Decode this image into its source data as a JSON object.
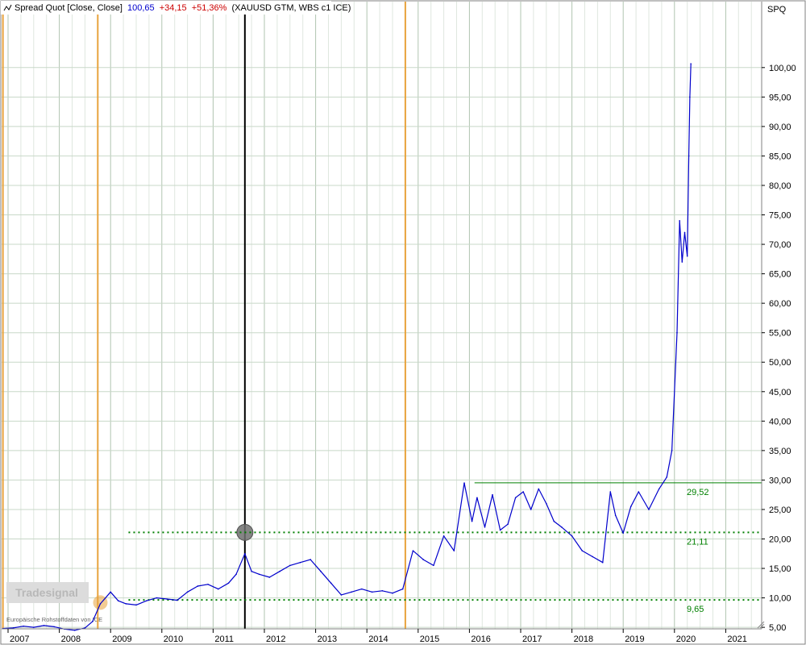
{
  "header": {
    "icon": "line-chart-icon",
    "label": "Spread Quot [Close, Close]",
    "last_value": "100,65",
    "change_abs": "+34,15",
    "change_pct": "+51,36%",
    "instruments": "(XAUUSD GTM, WBS c1 ICE)",
    "colors": {
      "label": "#000000",
      "last_value": "#0000cc",
      "change": "#cc0000"
    }
  },
  "axis": {
    "symbol": "SPQ",
    "y_ticks": [
      "5,00",
      "10,00",
      "15,00",
      "20,00",
      "25,00",
      "30,00",
      "35,00",
      "40,00",
      "45,00",
      "50,00",
      "55,00",
      "60,00",
      "65,00",
      "70,00",
      "75,00",
      "80,00",
      "85,00",
      "90,00",
      "95,00",
      "100,00"
    ],
    "x_ticks": [
      "2007",
      "2008",
      "2009",
      "2010",
      "2011",
      "2012",
      "2013",
      "2014",
      "2015",
      "2016",
      "2017",
      "2018",
      "2019",
      "2020",
      "2021"
    ]
  },
  "levels": [
    {
      "value": 29.52,
      "label": "29,52",
      "style": "solid",
      "from": 2016.1
    },
    {
      "value": 21.11,
      "label": "21,11",
      "style": "dotted",
      "from": 2009.35
    },
    {
      "value": 9.65,
      "label": "9,65",
      "style": "dotted",
      "from": 2009.35
    }
  ],
  "markers": {
    "orange_lines": [
      2006.9,
      2008.75,
      2014.75
    ],
    "black_line": 2011.62,
    "grey_circle": {
      "x": 2011.62,
      "y": 21.11
    },
    "orange_circle": {
      "x": 2008.8,
      "y": 9.2
    }
  },
  "watermark": {
    "logo_text": "Tradesignal",
    "caption": "Europäische Rohstoffdaten von ICE"
  },
  "colors": {
    "series": "#0000cc",
    "level": "#008000",
    "level_label": "#008000",
    "orange": "#e8a33d",
    "marker_black": "#000000",
    "grid": "#c8d8c8"
  },
  "chart_data": {
    "type": "line",
    "title": "",
    "xlabel": "",
    "ylabel": "SPQ",
    "xlim": [
      2006.8,
      2021.7
    ],
    "ylim": [
      0,
      105
    ],
    "grid": true,
    "series": [
      {
        "name": "Spread Quot",
        "x": [
          2006.9,
          2007.1,
          2007.3,
          2007.5,
          2007.7,
          2007.9,
          2008.1,
          2008.3,
          2008.5,
          2008.65,
          2008.8,
          2009.0,
          2009.15,
          2009.3,
          2009.5,
          2009.7,
          2009.9,
          2010.1,
          2010.3,
          2010.5,
          2010.7,
          2010.9,
          2011.1,
          2011.3,
          2011.45,
          2011.62,
          2011.75,
          2011.9,
          2012.1,
          2012.3,
          2012.5,
          2012.7,
          2012.9,
          2013.1,
          2013.3,
          2013.5,
          2013.7,
          2013.9,
          2014.1,
          2014.3,
          2014.5,
          2014.7,
          2014.9,
          2015.1,
          2015.3,
          2015.5,
          2015.7,
          2015.9,
          2016.05,
          2016.15,
          2016.3,
          2016.45,
          2016.6,
          2016.75,
          2016.9,
          2017.05,
          2017.2,
          2017.35,
          2017.5,
          2017.65,
          2017.8,
          2018.0,
          2018.2,
          2018.4,
          2018.6,
          2018.75,
          2018.85,
          2019.0,
          2019.15,
          2019.3,
          2019.5,
          2019.7,
          2019.85,
          2019.95,
          2020.05,
          2020.1,
          2020.15,
          2020.2,
          2020.25,
          2020.28,
          2020.3,
          2020.32
        ],
        "values": [
          4.8,
          4.9,
          5.2,
          5.0,
          5.3,
          5.1,
          4.7,
          4.5,
          4.9,
          6.0,
          9.0,
          11.0,
          9.5,
          9.0,
          8.8,
          9.5,
          10.0,
          9.8,
          9.6,
          11.0,
          12.0,
          12.3,
          11.5,
          12.5,
          14.0,
          17.5,
          14.5,
          14.0,
          13.5,
          14.5,
          15.5,
          16.0,
          16.5,
          14.5,
          12.5,
          10.5,
          11.0,
          11.5,
          11.0,
          11.2,
          10.8,
          11.5,
          18.0,
          16.5,
          15.5,
          20.5,
          18.0,
          29.5,
          23.0,
          27.0,
          22.0,
          27.5,
          21.5,
          22.5,
          27.0,
          28.0,
          25.0,
          28.5,
          26.0,
          23.0,
          22.0,
          20.5,
          18.0,
          17.0,
          16.0,
          28.0,
          24.0,
          21.0,
          25.5,
          28.0,
          25.0,
          28.5,
          30.5,
          35.0,
          55.0,
          74.0,
          67.0,
          72.0,
          68.0,
          85.0,
          95.0,
          100.65
        ]
      }
    ]
  }
}
